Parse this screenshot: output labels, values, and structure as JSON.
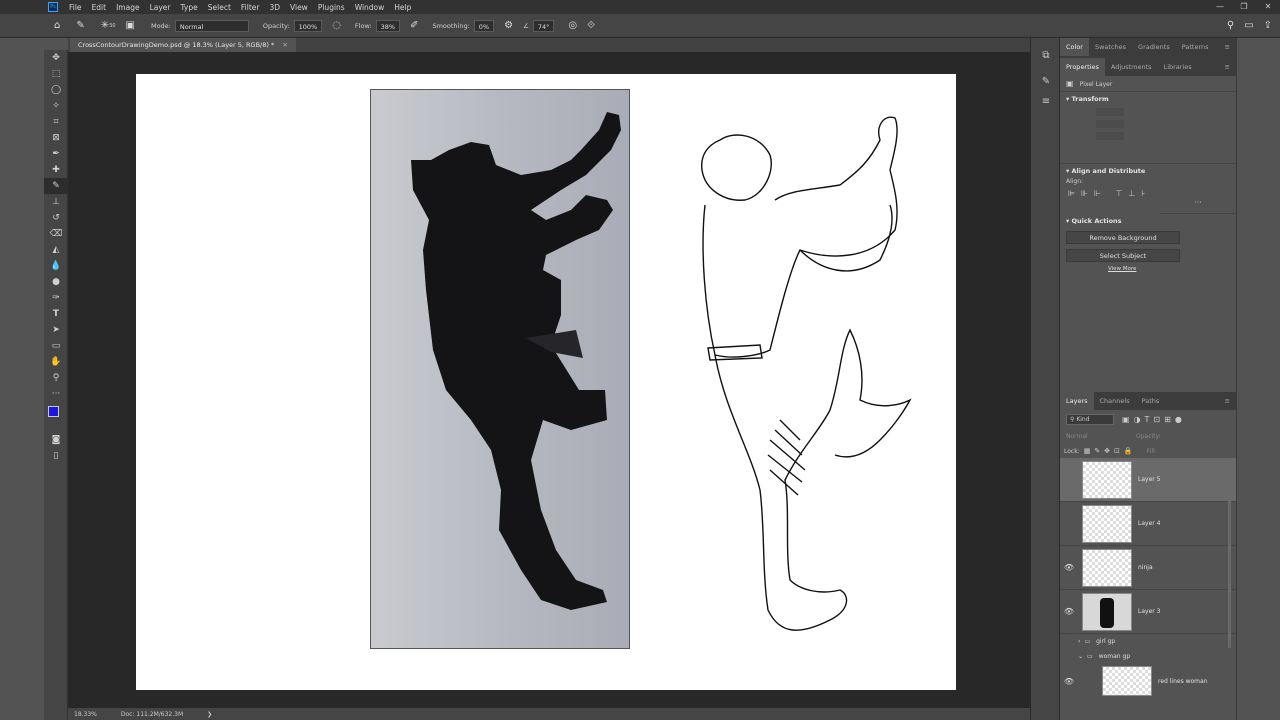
{
  "menubar": {
    "app_icon": "Ps",
    "items": [
      "File",
      "Edit",
      "Image",
      "Layer",
      "Type",
      "Select",
      "Filter",
      "3D",
      "View",
      "Plugins",
      "Window",
      "Help"
    ]
  },
  "options": {
    "mode_label": "Mode:",
    "mode_value": "Normal",
    "opacity_label": "Opacity:",
    "opacity_value": "100%",
    "flow_label": "Flow:",
    "flow_value": "38%",
    "smoothing_label": "Smoothing:",
    "smoothing_value": "0%",
    "angle_value": "74°",
    "brush_size": "30"
  },
  "document": {
    "tab_title": "CrossContourDrawingDemo.psd @ 18.3% (Layer 5, RGB/8) *",
    "zoom": "18.33%",
    "doc_info": "Doc: 111.2M/632.3M"
  },
  "colors": {
    "foreground": "#1a17e6",
    "background": "#ffffff"
  },
  "panels": {
    "top_tabs": [
      "Color",
      "Swatches",
      "Gradients",
      "Patterns"
    ],
    "prop_tabs": [
      "Properties",
      "Adjustments",
      "Libraries"
    ],
    "pixel_layer": "Pixel Layer",
    "transform": "Transform",
    "align": "Align and Distribute",
    "align_label": "Align:",
    "quick_actions": "Quick Actions",
    "remove_bg": "Remove Background",
    "select_subject": "Select Subject",
    "view_more": "View More"
  },
  "layers_panel": {
    "tabs": [
      "Layers",
      "Channels",
      "Paths"
    ],
    "filter": "Kind",
    "blend": "Normal",
    "opacity_label": "Opacity:",
    "lock_label": "Lock:",
    "fill_label": "Fill:",
    "layers": [
      {
        "name": "Layer 5",
        "visible": false,
        "selected": true
      },
      {
        "name": "Layer 4",
        "visible": false,
        "selected": false
      },
      {
        "name": "ninja",
        "visible": true,
        "selected": false
      },
      {
        "name": "Layer 3",
        "visible": true,
        "selected": false
      }
    ],
    "groups": [
      "girl gp",
      "woman gp"
    ],
    "bottom_layer": "red lines woman"
  }
}
